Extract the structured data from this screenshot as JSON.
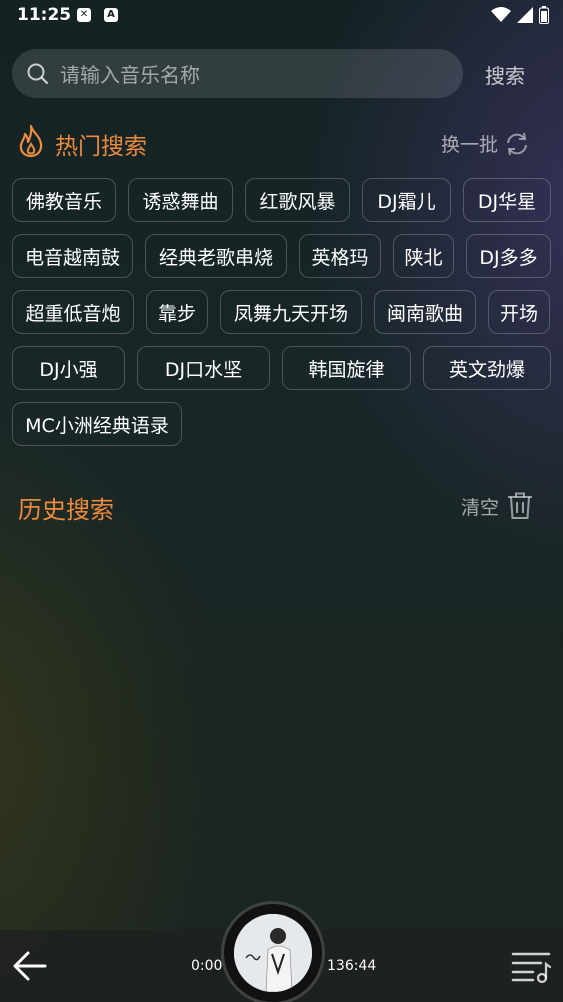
{
  "status_bar": {
    "time": "11:25",
    "notification_icons": [
      "shield-x-icon",
      "a-icon"
    ],
    "system_icons": [
      "wifi-icon",
      "signal-icon",
      "battery-icon"
    ]
  },
  "search": {
    "placeholder": "请输入音乐名称",
    "value": "",
    "button_label": "搜索"
  },
  "hot_search": {
    "title": "热门搜索",
    "refresh_label": "换一批",
    "rows": [
      [
        "佛教音乐",
        "诱惑舞曲",
        "红歌风暴",
        "DJ霜儿",
        "DJ华星"
      ],
      [
        "电音越南鼓",
        "经典老歌串烧",
        "英格玛",
        "陕北",
        "DJ多多"
      ],
      [
        "超重低音炮",
        "靠步",
        "凤舞九天开场",
        "闽南歌曲",
        "开场"
      ],
      [
        "DJ小强",
        "DJ口水坚",
        "韩国旋律",
        "英文劲爆"
      ],
      [
        "MC小洲经典语录"
      ]
    ]
  },
  "history": {
    "title": "历史搜索",
    "clear_label": "清空",
    "items": []
  },
  "player": {
    "current_time": "0:00",
    "total_time": "136:44"
  },
  "colors": {
    "accent": "#ec8b3d",
    "tag_border": "#3a4644"
  }
}
